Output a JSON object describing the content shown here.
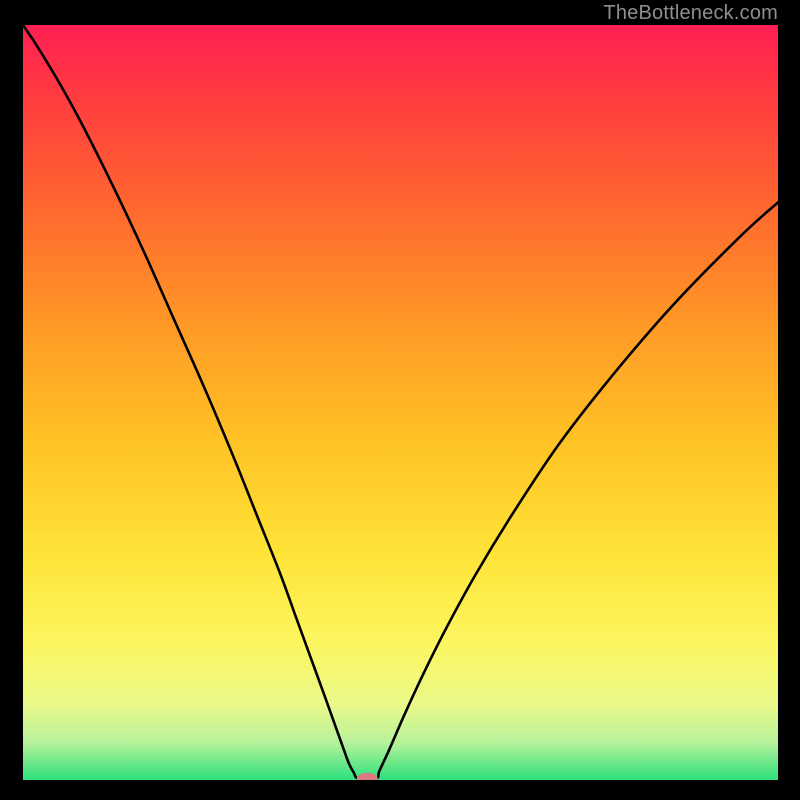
{
  "watermark": "TheBottleneck.com",
  "chart_data": {
    "type": "line",
    "title": "",
    "xlabel": "",
    "ylabel": "",
    "xlim": [
      0,
      100
    ],
    "ylim": [
      0,
      100
    ],
    "background_gradient": {
      "stops": [
        {
          "offset": 0.0,
          "color": "#ff1f52"
        },
        {
          "offset": 0.1,
          "color": "#ff3d3f"
        },
        {
          "offset": 0.25,
          "color": "#ff6a2e"
        },
        {
          "offset": 0.4,
          "color": "#ff9a26"
        },
        {
          "offset": 0.55,
          "color": "#ffc225"
        },
        {
          "offset": 0.7,
          "color": "#ffe338"
        },
        {
          "offset": 0.82,
          "color": "#fcf660"
        },
        {
          "offset": 0.9,
          "color": "#eaf98a"
        },
        {
          "offset": 0.95,
          "color": "#b7f29a"
        },
        {
          "offset": 1.0,
          "color": "#2de07c"
        }
      ]
    },
    "series": [
      {
        "name": "bottleneck-curve",
        "color": "#000000",
        "x": [
          0,
          2,
          5,
          8,
          12,
          16,
          20,
          24,
          28,
          31,
          34,
          36,
          38,
          40,
          41.5,
          42.5,
          43.2,
          43.8,
          44.4,
          46.8,
          47.2,
          48.5,
          50.5,
          53,
          56,
          60,
          65,
          71,
          78,
          86,
          95,
          100
        ],
        "y": [
          100,
          97,
          92,
          86.5,
          78.5,
          70,
          61,
          52,
          42.5,
          35,
          27.5,
          22,
          16.5,
          11,
          6.8,
          4,
          2.1,
          1.0,
          0.2,
          0.2,
          1.2,
          4.0,
          8.6,
          14,
          20,
          27.3,
          35.5,
          44.5,
          53.5,
          62.8,
          72,
          76.5
        ]
      }
    ],
    "marker": {
      "name": "optimal-point",
      "cx": 45.6,
      "cy": 0.2,
      "rx": 1.4,
      "ry": 0.75,
      "fill": "#d87a80"
    }
  }
}
